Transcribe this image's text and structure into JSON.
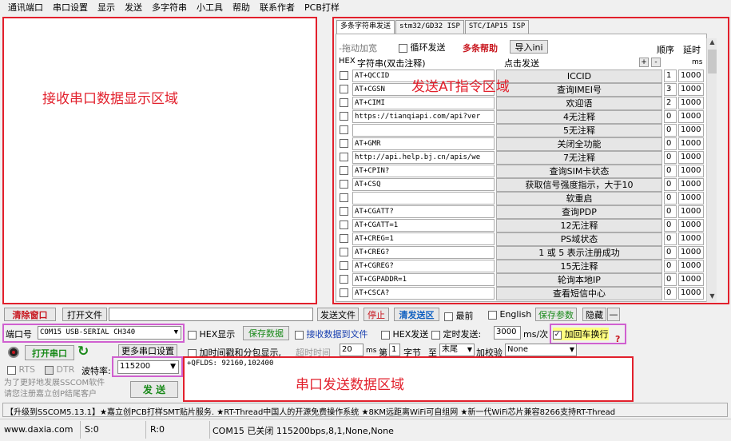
{
  "menu": [
    "通讯端口",
    "串口设置",
    "显示",
    "发送",
    "多字符串",
    "小工具",
    "帮助",
    "联系作者",
    "PCB打样"
  ],
  "annotations": {
    "recv": "接收串口数据显示区域",
    "at": "发送AT指令区域",
    "send": "串口发送数据区域"
  },
  "tabs": [
    "多条字符串发送",
    "stm32/GD32 ISP",
    "STC/IAP15 ISP"
  ],
  "toolbar": {
    "shrink": "-拖动加宽",
    "loop": "循环发送",
    "help": "多条帮助",
    "import": "导入ini",
    "order": "顺序",
    "delay": "延时",
    "hex": "HEX",
    "strcol": "字符串(双击注释)",
    "clicksend": "点击发送",
    "plus": "+",
    "minus": "-",
    "ms": "ms"
  },
  "rows": [
    {
      "cmd": "AT+QCCID",
      "label": "ICCID",
      "order": "1",
      "delay": "1000"
    },
    {
      "cmd": "AT+CGSN",
      "label": "查询IMEI号",
      "order": "3",
      "delay": "1000"
    },
    {
      "cmd": "AT+CIMI",
      "label": "欢迎语",
      "order": "2",
      "delay": "1000"
    },
    {
      "cmd": "https://tianqiapi.com/api?ver",
      "label": "4无注释",
      "order": "0",
      "delay": "1000"
    },
    {
      "cmd": "",
      "label": "5无注释",
      "order": "0",
      "delay": "1000"
    },
    {
      "cmd": "AT+GMR",
      "label": "关闭全功能",
      "order": "0",
      "delay": "1000"
    },
    {
      "cmd": "http://api.help.bj.cn/apis/we",
      "label": "7无注释",
      "order": "0",
      "delay": "1000"
    },
    {
      "cmd": "AT+CPIN?",
      "label": "查询SIM卡状态",
      "order": "0",
      "delay": "1000"
    },
    {
      "cmd": "AT+CSQ",
      "label": "获取信号强度指示，大于10",
      "order": "0",
      "delay": "1000"
    },
    {
      "cmd": "",
      "label": "软重启",
      "order": "0",
      "delay": "1000"
    },
    {
      "cmd": "AT+CGATT?",
      "label": "查询PDP",
      "order": "0",
      "delay": "1000"
    },
    {
      "cmd": "AT+CGATT=1",
      "label": "12无注释",
      "order": "0",
      "delay": "1000"
    },
    {
      "cmd": "AT+CREG=1",
      "label": "PS域状态",
      "order": "0",
      "delay": "1000"
    },
    {
      "cmd": "AT+CREG?",
      "label": "1 或 5 表示注册成功",
      "order": "0",
      "delay": "1000"
    },
    {
      "cmd": "AT+CGREG?",
      "label": "15无注释",
      "order": "0",
      "delay": "1000"
    },
    {
      "cmd": "AT+CGPADDR=1",
      "label": "轮询本地IP",
      "order": "0",
      "delay": "1000"
    },
    {
      "cmd": "AT+CSCA?",
      "label": "查看短信中心",
      "order": "0",
      "delay": "1000"
    }
  ],
  "bar1": {
    "clear": "清除窗口",
    "openfile": "打开文件",
    "sendfile": "发送文件",
    "stop": "停止",
    "clearsend": "清发送区",
    "last": "最前",
    "english": "English",
    "saveparam": "保存参数",
    "hide": "隐藏",
    "dash": "—"
  },
  "bar2": {
    "portlabel": "端口号",
    "port": "COM15 USB-SERIAL CH340",
    "hexshow": "HEX显示",
    "savedata": "保存数据",
    "recvfile": "接收数据到文件",
    "hexsend": "HEX发送",
    "timedsend": "定时发送:",
    "interval": "3000",
    "msper": "ms/次",
    "crlf": "加回车换行",
    "q": "?"
  },
  "bar3": {
    "openport": "打开串口",
    "moreset": "更多串口设置",
    "timestamp": "加时间戳和分包显示,",
    "timeout": "超时时间",
    "timeoutval": "20",
    "ms": "ms",
    "byteno": "第",
    "bytenoval": "1",
    "bytes": "字节",
    "to": "至",
    "end": "末尾",
    "checksum": "加校验",
    "checkval": "None"
  },
  "bar4": {
    "rts": "RTS",
    "dtr": "DTR",
    "baudlabel": "波特率:",
    "baud": "115200"
  },
  "sendtext": "+QFLDS: 92160,102400",
  "promo": "为了更好地发展SSCOM软件\n请您注册嘉立创P结尾客户",
  "sendbtn": "发 送",
  "ticker": "【升级到SSCOM5.13.1】★嘉立创PCB打样SMT贴片服务. ★RT-Thread中国人的开源免费操作系统 ★8KM远距离WiFi可自组网 ★新一代WiFi芯片兼容8266支持RT-Thread",
  "status": {
    "site": "www.daxia.com",
    "s": "S:0",
    "r": "R:0",
    "port": "COM15 已关闭  115200bps,8,1,None,None"
  }
}
